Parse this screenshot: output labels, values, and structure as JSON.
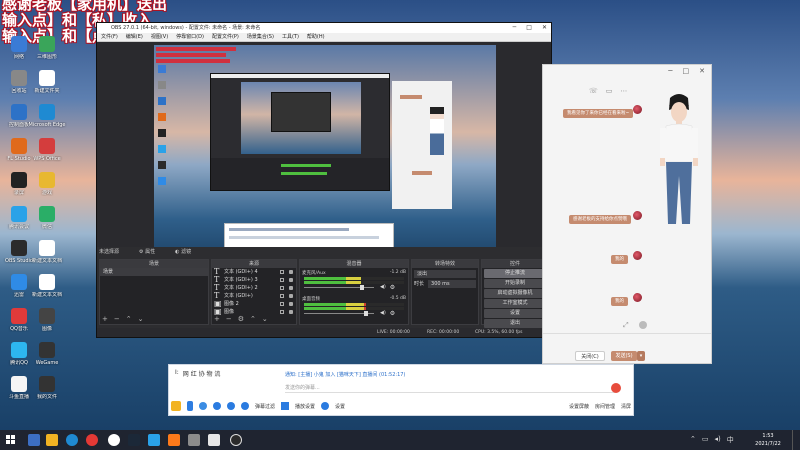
{
  "overlay": {
    "line1": "感谢老板【家用机】送出",
    "line2": "输入点】和【私】收入",
    "line3": "输入点】和【点】口粮"
  },
  "desktop_icons": [
    {
      "label": "网络",
      "icon": "network-icon",
      "color": "#3a7bd5"
    },
    {
      "label": "三维图形",
      "icon": "app-icon",
      "color": "#3aa55a"
    },
    {
      "label": "回收站",
      "icon": "recycle-bin-icon",
      "color": "#888888"
    },
    {
      "label": "新建文件夹",
      "icon": "file-icon",
      "color": "#ffffff"
    },
    {
      "label": "控制面板",
      "icon": "control-panel-icon",
      "color": "#2d72c7"
    },
    {
      "label": "Microsoft Edge",
      "icon": "edge-icon",
      "color": "#1f8ad2"
    },
    {
      "label": "FL Studio",
      "icon": "music-icon",
      "color": "#e06a1b"
    },
    {
      "label": "WPS Office",
      "icon": "wps-icon",
      "color": "#d43d3d"
    },
    {
      "label": "录屏",
      "icon": "record-icon",
      "color": "#222222"
    },
    {
      "label": "游戏",
      "icon": "folder-icon",
      "color": "#e8b830"
    },
    {
      "label": "腾讯会议",
      "icon": "app-icon",
      "color": "#2aa2e8"
    },
    {
      "label": "微信",
      "icon": "wechat-icon",
      "color": "#2aae67"
    },
    {
      "label": "OBS Studio",
      "icon": "obs-icon",
      "color": "#2b2b2b"
    },
    {
      "label": "新建文本文档",
      "icon": "file-icon",
      "color": "#ffffff"
    },
    {
      "label": "迅雷",
      "icon": "app-icon",
      "color": "#2f8be6"
    },
    {
      "label": "新建文本文档",
      "icon": "file-icon",
      "color": "#ffffff"
    },
    {
      "label": "QQ音乐",
      "icon": "music-icon",
      "color": "#e03a3a"
    },
    {
      "label": "图像",
      "icon": "image-icon",
      "color": "#444444"
    },
    {
      "label": "腾讯QQ",
      "icon": "qq-icon",
      "color": "#2db6f0"
    },
    {
      "label": "WeGame",
      "icon": "game-icon",
      "color": "#333333"
    },
    {
      "label": "斗鱼直播",
      "icon": "douyu-icon",
      "color": "#f5f5f5"
    },
    {
      "label": "我的文件",
      "icon": "folder-icon",
      "color": "#333333"
    }
  ],
  "obs": {
    "title": "OBS 27.0.1 (64-bit, windows) - 配置文件: 未命名 - 场景: 未命名",
    "menu": [
      "文件(F)",
      "编辑(E)",
      "视图(V)",
      "停靠窗口(D)",
      "配置文件(P)",
      "场景集合(S)",
      "工具(T)",
      "帮助(H)"
    ],
    "no_source_label": "未选择源",
    "properties_label": "属性",
    "filters_label": "滤镜",
    "scenes_header": "场景",
    "scene_item": "场景",
    "sources_header": "来源",
    "sources": [
      {
        "icon": "T",
        "name": "文本 (GDI+) 4"
      },
      {
        "icon": "T",
        "name": "文本 (GDI+) 3"
      },
      {
        "icon": "T",
        "name": "文本 (GDI+) 2"
      },
      {
        "icon": "T",
        "name": "文本 (GDI+)"
      },
      {
        "icon": "▣",
        "name": "图像 2"
      },
      {
        "icon": "▣",
        "name": "图像"
      }
    ],
    "mixer_header": "混音器",
    "mixer": [
      {
        "name": "麦克风/Aux",
        "db": "-1.2 dB",
        "level": 0.82
      },
      {
        "name": "桌面音频",
        "db": "-0.5 dB",
        "level": 0.88
      }
    ],
    "transitions_header": "转场特效",
    "transition_value": "淡出",
    "duration_label": "时长",
    "duration_value": "300 ms",
    "controls_header": "控件",
    "controls": [
      "停止推流",
      "开始录制",
      "启动虚拟摄像机",
      "工作室模式",
      "设置",
      "退出"
    ],
    "status": {
      "live": "LIVE: 00:00:00",
      "rec": "REC: 00:00:00",
      "cpu": "CPU: 3.5%, 60.00 fps"
    }
  },
  "chat": {
    "bubbles": [
      "我看见你了来你已经在看来啦~",
      "感谢老板的支持给你点赞哦",
      "我的",
      "我的"
    ],
    "close_button": "关闭(C)",
    "send_button": "发送(S)"
  },
  "danmaku": {
    "row1_prefix": "I:",
    "row1_text": "网  红  协  物  流",
    "row2_notice": "通知: [主播] 小鬼 加入 [猫咪天下] 直播间 (01:52:17)",
    "row3_placeholder": "发送你的弹幕...",
    "tools": [
      "表情",
      "截图",
      "投屏",
      "语音",
      "图片",
      "发送"
    ],
    "bottom_tabs": [
      "弹幕过滤",
      "播放设置",
      "设置"
    ],
    "bottom_right": [
      "设置屏蔽",
      "房间管理",
      "清屏"
    ]
  },
  "taskbar": {
    "time": "1:53",
    "date": "2021/7/22",
    "lang": "中"
  }
}
